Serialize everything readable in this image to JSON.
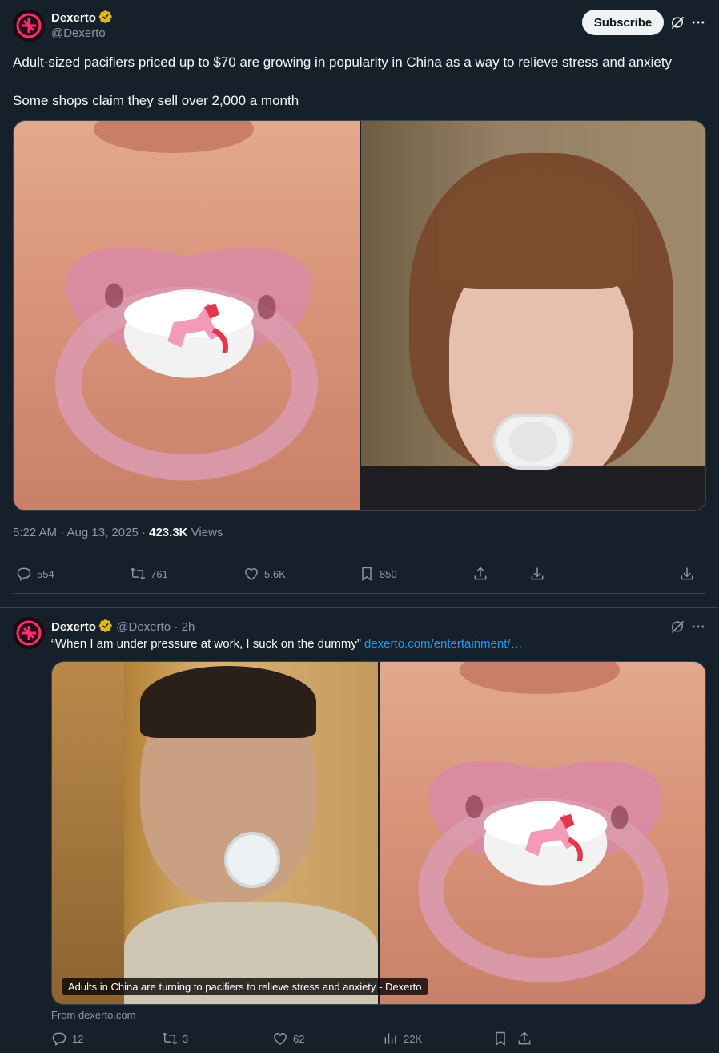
{
  "post1": {
    "author_name": "Dexerto",
    "author_handle": "@Dexerto",
    "subscribe_label": "Subscribe",
    "text_line1": "Adult-sized pacifiers priced up to $70 are growing in popularity in China as a way to relieve stress and anxiety",
    "text_line2": "Some shops claim they sell over 2,000 a month",
    "timestamp": "5:22 AM · Aug 13, 2025 · ",
    "views_count": "423.3K",
    "views_label": " Views",
    "replies": "554",
    "reposts": "761",
    "likes": "5.6K",
    "bookmarks": "850"
  },
  "post2": {
    "author_name": "Dexerto",
    "author_handle": "@Dexerto",
    "time_ago": "· 2h",
    "quote_text": "“When I am under pressure at work, I suck on the dummy”",
    "link_text": "dexerto.com/entertainment/…",
    "card_caption": "Adults in China are turning to pacifiers to relieve stress and anxiety - Dexerto",
    "from_label": "From dexerto.com",
    "replies": "12",
    "reposts": "3",
    "likes": "62",
    "views": "22K"
  },
  "colors": {
    "background": "#15202b",
    "text": "#f7f9f9",
    "muted": "#8b98a5",
    "link": "#1d9bf0",
    "verified": "#e2b719",
    "divider": "#38444d"
  },
  "icons": [
    "verified-badge-icon",
    "grok-icon",
    "more-icon",
    "reply-icon",
    "repost-icon",
    "like-icon",
    "bookmark-icon",
    "share-icon",
    "download-icon",
    "views-icon"
  ]
}
